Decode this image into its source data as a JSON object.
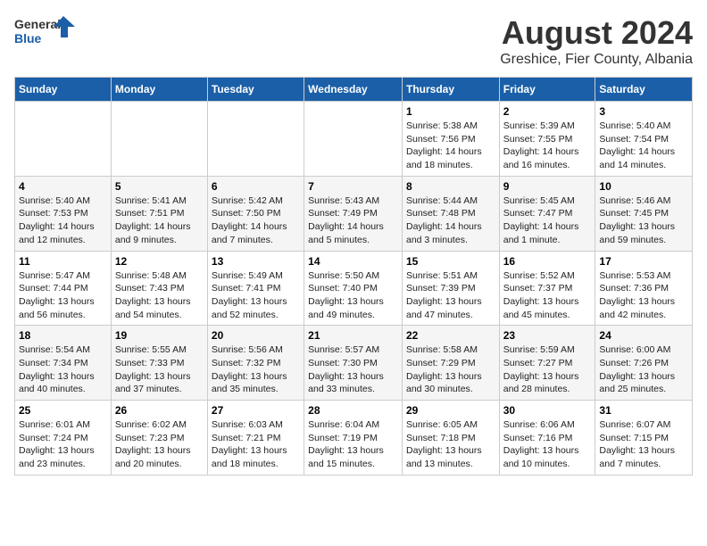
{
  "header": {
    "logo_general": "General",
    "logo_blue": "Blue",
    "month": "August 2024",
    "location": "Greshice, Fier County, Albania"
  },
  "weekdays": [
    "Sunday",
    "Monday",
    "Tuesday",
    "Wednesday",
    "Thursday",
    "Friday",
    "Saturday"
  ],
  "weeks": [
    [
      {
        "day": "",
        "content": ""
      },
      {
        "day": "",
        "content": ""
      },
      {
        "day": "",
        "content": ""
      },
      {
        "day": "",
        "content": ""
      },
      {
        "day": "1",
        "content": "Sunrise: 5:38 AM\nSunset: 7:56 PM\nDaylight: 14 hours\nand 18 minutes."
      },
      {
        "day": "2",
        "content": "Sunrise: 5:39 AM\nSunset: 7:55 PM\nDaylight: 14 hours\nand 16 minutes."
      },
      {
        "day": "3",
        "content": "Sunrise: 5:40 AM\nSunset: 7:54 PM\nDaylight: 14 hours\nand 14 minutes."
      }
    ],
    [
      {
        "day": "4",
        "content": "Sunrise: 5:40 AM\nSunset: 7:53 PM\nDaylight: 14 hours\nand 12 minutes."
      },
      {
        "day": "5",
        "content": "Sunrise: 5:41 AM\nSunset: 7:51 PM\nDaylight: 14 hours\nand 9 minutes."
      },
      {
        "day": "6",
        "content": "Sunrise: 5:42 AM\nSunset: 7:50 PM\nDaylight: 14 hours\nand 7 minutes."
      },
      {
        "day": "7",
        "content": "Sunrise: 5:43 AM\nSunset: 7:49 PM\nDaylight: 14 hours\nand 5 minutes."
      },
      {
        "day": "8",
        "content": "Sunrise: 5:44 AM\nSunset: 7:48 PM\nDaylight: 14 hours\nand 3 minutes."
      },
      {
        "day": "9",
        "content": "Sunrise: 5:45 AM\nSunset: 7:47 PM\nDaylight: 14 hours\nand 1 minute."
      },
      {
        "day": "10",
        "content": "Sunrise: 5:46 AM\nSunset: 7:45 PM\nDaylight: 13 hours\nand 59 minutes."
      }
    ],
    [
      {
        "day": "11",
        "content": "Sunrise: 5:47 AM\nSunset: 7:44 PM\nDaylight: 13 hours\nand 56 minutes."
      },
      {
        "day": "12",
        "content": "Sunrise: 5:48 AM\nSunset: 7:43 PM\nDaylight: 13 hours\nand 54 minutes."
      },
      {
        "day": "13",
        "content": "Sunrise: 5:49 AM\nSunset: 7:41 PM\nDaylight: 13 hours\nand 52 minutes."
      },
      {
        "day": "14",
        "content": "Sunrise: 5:50 AM\nSunset: 7:40 PM\nDaylight: 13 hours\nand 49 minutes."
      },
      {
        "day": "15",
        "content": "Sunrise: 5:51 AM\nSunset: 7:39 PM\nDaylight: 13 hours\nand 47 minutes."
      },
      {
        "day": "16",
        "content": "Sunrise: 5:52 AM\nSunset: 7:37 PM\nDaylight: 13 hours\nand 45 minutes."
      },
      {
        "day": "17",
        "content": "Sunrise: 5:53 AM\nSunset: 7:36 PM\nDaylight: 13 hours\nand 42 minutes."
      }
    ],
    [
      {
        "day": "18",
        "content": "Sunrise: 5:54 AM\nSunset: 7:34 PM\nDaylight: 13 hours\nand 40 minutes."
      },
      {
        "day": "19",
        "content": "Sunrise: 5:55 AM\nSunset: 7:33 PM\nDaylight: 13 hours\nand 37 minutes."
      },
      {
        "day": "20",
        "content": "Sunrise: 5:56 AM\nSunset: 7:32 PM\nDaylight: 13 hours\nand 35 minutes."
      },
      {
        "day": "21",
        "content": "Sunrise: 5:57 AM\nSunset: 7:30 PM\nDaylight: 13 hours\nand 33 minutes."
      },
      {
        "day": "22",
        "content": "Sunrise: 5:58 AM\nSunset: 7:29 PM\nDaylight: 13 hours\nand 30 minutes."
      },
      {
        "day": "23",
        "content": "Sunrise: 5:59 AM\nSunset: 7:27 PM\nDaylight: 13 hours\nand 28 minutes."
      },
      {
        "day": "24",
        "content": "Sunrise: 6:00 AM\nSunset: 7:26 PM\nDaylight: 13 hours\nand 25 minutes."
      }
    ],
    [
      {
        "day": "25",
        "content": "Sunrise: 6:01 AM\nSunset: 7:24 PM\nDaylight: 13 hours\nand 23 minutes."
      },
      {
        "day": "26",
        "content": "Sunrise: 6:02 AM\nSunset: 7:23 PM\nDaylight: 13 hours\nand 20 minutes."
      },
      {
        "day": "27",
        "content": "Sunrise: 6:03 AM\nSunset: 7:21 PM\nDaylight: 13 hours\nand 18 minutes."
      },
      {
        "day": "28",
        "content": "Sunrise: 6:04 AM\nSunset: 7:19 PM\nDaylight: 13 hours\nand 15 minutes."
      },
      {
        "day": "29",
        "content": "Sunrise: 6:05 AM\nSunset: 7:18 PM\nDaylight: 13 hours\nand 13 minutes."
      },
      {
        "day": "30",
        "content": "Sunrise: 6:06 AM\nSunset: 7:16 PM\nDaylight: 13 hours\nand 10 minutes."
      },
      {
        "day": "31",
        "content": "Sunrise: 6:07 AM\nSunset: 7:15 PM\nDaylight: 13 hours\nand 7 minutes."
      }
    ]
  ]
}
